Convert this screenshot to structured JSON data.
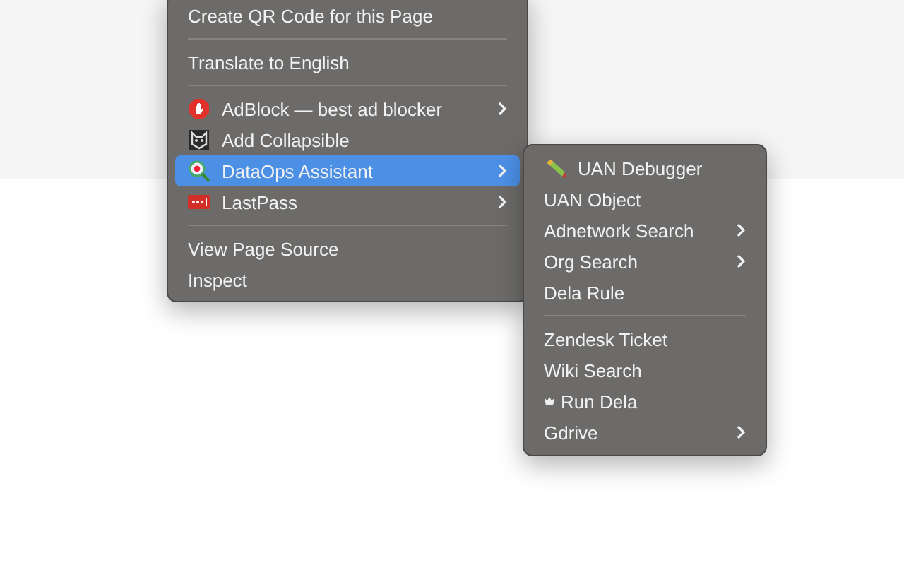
{
  "context_menu": {
    "items": [
      {
        "kind": "item",
        "label": "Create QR Code for this Page",
        "selected": false,
        "submenu": false
      },
      {
        "kind": "separator"
      },
      {
        "kind": "item",
        "label": "Translate to English",
        "selected": false,
        "submenu": false
      },
      {
        "kind": "separator"
      },
      {
        "kind": "item",
        "label": "AdBlock — best ad blocker",
        "selected": false,
        "submenu": true
      },
      {
        "kind": "item",
        "label": "Add Collapsible",
        "selected": false,
        "submenu": false
      },
      {
        "kind": "item",
        "label": "DataOps Assistant",
        "selected": true,
        "submenu": true
      },
      {
        "kind": "item",
        "label": "LastPass",
        "selected": false,
        "submenu": true
      },
      {
        "kind": "separator"
      },
      {
        "kind": "item",
        "label": "View Page Source",
        "selected": false,
        "submenu": false
      },
      {
        "kind": "item",
        "label": "Inspect",
        "selected": false,
        "submenu": false
      }
    ]
  },
  "submenu": {
    "items": [
      {
        "kind": "item",
        "label": "UAN Debugger",
        "selected": false,
        "submenu": false
      },
      {
        "kind": "item",
        "label": "UAN Object",
        "selected": false,
        "submenu": false
      },
      {
        "kind": "item",
        "label": "Adnetwork Search",
        "selected": false,
        "submenu": true
      },
      {
        "kind": "item",
        "label": "Org Search",
        "selected": false,
        "submenu": true
      },
      {
        "kind": "item",
        "label": "Dela Rule",
        "selected": false,
        "submenu": false
      },
      {
        "kind": "separator"
      },
      {
        "kind": "item",
        "label": "Zendesk Ticket",
        "selected": false,
        "submenu": false
      },
      {
        "kind": "item",
        "label": "Wiki Search",
        "selected": false,
        "submenu": false
      },
      {
        "kind": "item",
        "label": "Run Dela",
        "selected": false,
        "submenu": false
      },
      {
        "kind": "item",
        "label": "Gdrive",
        "selected": false,
        "submenu": true
      }
    ]
  }
}
